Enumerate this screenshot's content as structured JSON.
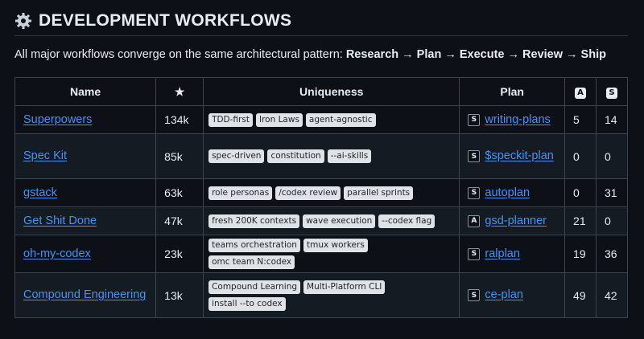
{
  "heading": {
    "title": "DEVELOPMENT WORKFLOWS",
    "icon": "gear-icon"
  },
  "subtitle": {
    "prefix": "All major workflows converge on the same architectural pattern: ",
    "pattern": "Research → Plan → Execute → Review → Ship"
  },
  "table": {
    "headers": {
      "name": "Name",
      "star": "★",
      "uniqueness": "Uniqueness",
      "plan": "Plan",
      "col_a": "A",
      "col_s": "S"
    },
    "rows": [
      {
        "name": "Superpowers",
        "stars": "134k",
        "tags": [
          "TDD-first",
          "Iron Laws",
          "agent-agnostic"
        ],
        "plan_icon": "S",
        "plan": "writing-plans",
        "a": "5",
        "s": "14"
      },
      {
        "name": "Spec Kit",
        "stars": "85k",
        "tags": [
          "spec-driven",
          "constitution",
          "--ai-skills"
        ],
        "plan_icon": "S",
        "plan": "$speckit-plan",
        "a": "0",
        "s": "0"
      },
      {
        "name": "gstack",
        "stars": "63k",
        "tags": [
          "role personas",
          "/codex review",
          "parallel sprints"
        ],
        "plan_icon": "S",
        "plan": "autoplan",
        "a": "0",
        "s": "31"
      },
      {
        "name": "Get Shit Done",
        "stars": "47k",
        "tags": [
          "fresh 200K contexts",
          "wave execution",
          "--codex flag"
        ],
        "plan_icon": "A",
        "plan": "gsd-planner",
        "a": "21",
        "s": "0"
      },
      {
        "name": "oh-my-codex",
        "stars": "23k",
        "tags": [
          "teams orchestration",
          "tmux workers",
          "omc team N:codex"
        ],
        "plan_icon": "S",
        "plan": "ralplan",
        "a": "19",
        "s": "36"
      },
      {
        "name": "Compound Engineering",
        "stars": "13k",
        "tags": [
          "Compound Learning",
          "Multi-Platform CLI",
          "install --to codex"
        ],
        "plan_icon": "S",
        "plan": "ce-plan",
        "a": "49",
        "s": "42"
      }
    ]
  }
}
